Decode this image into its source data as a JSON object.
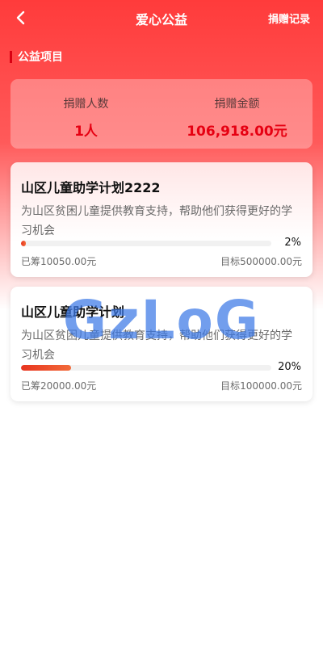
{
  "header": {
    "title": "爱心公益",
    "action_label": "捐赠记录",
    "back_icon": "chevron-left-icon"
  },
  "section": {
    "title": "公益项目"
  },
  "stats": {
    "donors_label": "捐赠人数",
    "donors_value": "1人",
    "amount_label": "捐赠金额",
    "amount_value": "106,918.00元"
  },
  "projects": [
    {
      "title": "山区儿童助学计划2222",
      "description": "为山区贫困儿童提供教育支持，帮助他们获得更好的学习机会",
      "progress_label": "2%",
      "progress": 0.02,
      "raised": "已筹10050.00元",
      "target": "目标500000.00元"
    },
    {
      "title": "山区儿童助学计划",
      "description": "为山区贫困儿童提供教育支持，帮助他们获得更好的学习机会",
      "progress_label": "20%",
      "progress": 0.2,
      "raised": "已筹20000.00元",
      "target": "目标100000.00元"
    }
  ],
  "watermark": "GzLoG",
  "colors": {
    "brand": "#ff3b3b",
    "accent": "#e60012",
    "progress_fill": "#e8341f",
    "watermark": "#3c78e6"
  }
}
